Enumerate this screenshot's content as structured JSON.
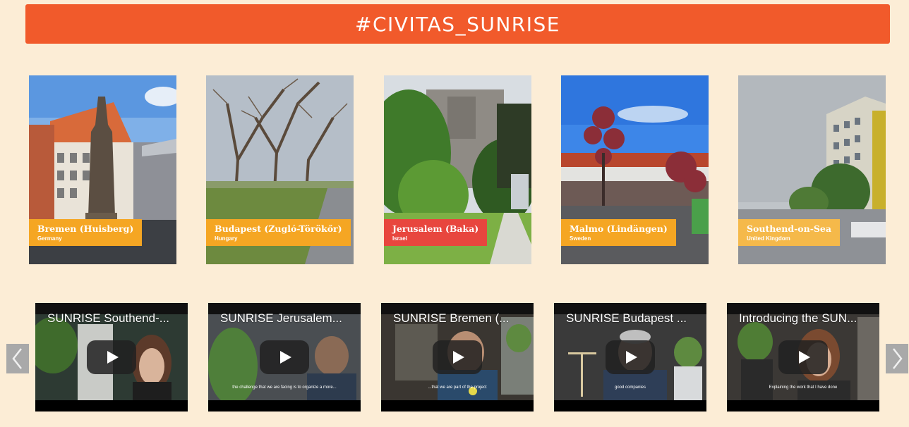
{
  "banner": {
    "title": "#CIVITAS_SUNRISE",
    "color": "#f15a2b"
  },
  "cities": [
    {
      "name": "Bremen (Huisberg)",
      "country": "Germany",
      "label_color": "#f5a623"
    },
    {
      "name": "Budapest (Zugló-Törökőr)",
      "country": "Hungary",
      "label_color": "#f5a623"
    },
    {
      "name": "Jerusalem (Baka)",
      "country": "Israel",
      "label_color": "#e8463e"
    },
    {
      "name": "Malmo (Lindängen)",
      "country": "Sweden",
      "label_color": "#f5a623"
    },
    {
      "name": "Southend-on-Sea",
      "country": "United Kingdom",
      "label_color": "#f5b94a"
    }
  ],
  "videos": [
    {
      "title": "SUNRISE Southend-...",
      "subtitle": ""
    },
    {
      "title": "SUNRISE Jerusalem...",
      "subtitle": "the challenge that we are facing is to organize a more..."
    },
    {
      "title": "SUNRISE Bremen (...",
      "subtitle": "...that we are part of the project"
    },
    {
      "title": "SUNRISE Budapest ...",
      "subtitle": "good companies"
    },
    {
      "title": "Introducing the SUN...",
      "subtitle": "Explaining the work that I have done"
    }
  ],
  "carousel": {
    "prev_icon": "chevron-left-icon",
    "next_icon": "chevron-right-icon"
  },
  "colors": {
    "background": "#fcedd6",
    "label_orange": "#f5a623",
    "label_red": "#e8463e"
  }
}
